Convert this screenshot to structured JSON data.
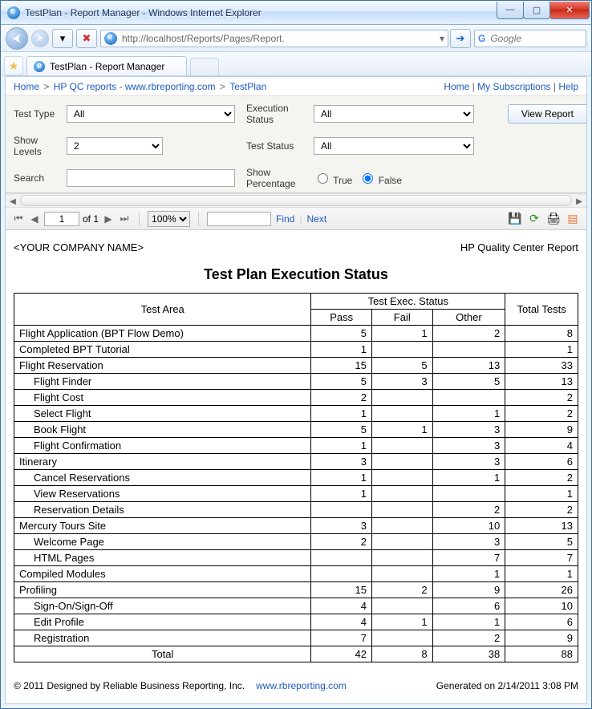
{
  "window": {
    "title": "TestPlan - Report Manager - Windows Internet Explorer"
  },
  "address": {
    "url_display": "http://localhost/Reports/Pages/Report."
  },
  "search": {
    "placeholder": "Google"
  },
  "tab": {
    "title": "TestPlan - Report Manager"
  },
  "breadcrumbs": {
    "left": [
      "Home",
      "HP QC reports - www.rbreporting.com",
      "TestPlan"
    ],
    "right": [
      "Home",
      "My Subscriptions",
      "Help"
    ]
  },
  "params": {
    "test_type_label": "Test Type",
    "test_type_value": "All",
    "exec_status_label": "Execution Status",
    "exec_status_value": "All",
    "show_levels_label": "Show Levels",
    "show_levels_value": "2",
    "test_status_label": "Test Status",
    "test_status_value": "All",
    "search_label": "Search",
    "search_value": "",
    "show_pct_label": "Show Percentage",
    "show_pct_value": "False",
    "true_label": "True",
    "false_label": "False",
    "view_report_label": "View Report"
  },
  "report_toolbar": {
    "page_current": "1",
    "page_of": "of 1",
    "zoom": "100%",
    "find_label": "Find",
    "next_label": "Next"
  },
  "report": {
    "company": "<YOUR COMPANY NAME>",
    "subtitle_right": "HP Quality Center Report",
    "title": "Test Plan Execution Status",
    "headers": {
      "area": "Test Area",
      "exec_status": "Test Exec. Status",
      "total": "Total Tests",
      "pass": "Pass",
      "fail": "Fail",
      "other": "Other"
    },
    "rows": [
      {
        "name": "Flight Application (BPT Flow Demo)",
        "indent": 0,
        "pass": "5",
        "fail": "1",
        "other": "2",
        "total": "8"
      },
      {
        "name": "Completed BPT Tutorial",
        "indent": 0,
        "pass": "1",
        "fail": "",
        "other": "",
        "total": "1"
      },
      {
        "name": "Flight Reservation",
        "indent": 0,
        "pass": "15",
        "fail": "5",
        "other": "13",
        "total": "33"
      },
      {
        "name": "Flight Finder",
        "indent": 1,
        "pass": "5",
        "fail": "3",
        "other": "5",
        "total": "13"
      },
      {
        "name": "Flight Cost",
        "indent": 1,
        "pass": "2",
        "fail": "",
        "other": "",
        "total": "2"
      },
      {
        "name": "Select Flight",
        "indent": 1,
        "pass": "1",
        "fail": "",
        "other": "1",
        "total": "2"
      },
      {
        "name": "Book Flight",
        "indent": 1,
        "pass": "5",
        "fail": "1",
        "other": "3",
        "total": "9"
      },
      {
        "name": "Flight Confirmation",
        "indent": 1,
        "pass": "1",
        "fail": "",
        "other": "3",
        "total": "4"
      },
      {
        "name": "Itinerary",
        "indent": 0,
        "pass": "3",
        "fail": "",
        "other": "3",
        "total": "6"
      },
      {
        "name": "Cancel Reservations",
        "indent": 1,
        "pass": "1",
        "fail": "",
        "other": "1",
        "total": "2"
      },
      {
        "name": "View Reservations",
        "indent": 1,
        "pass": "1",
        "fail": "",
        "other": "",
        "total": "1"
      },
      {
        "name": "Reservation Details",
        "indent": 1,
        "pass": "",
        "fail": "",
        "other": "2",
        "total": "2"
      },
      {
        "name": "Mercury Tours Site",
        "indent": 0,
        "pass": "3",
        "fail": "",
        "other": "10",
        "total": "13"
      },
      {
        "name": "Welcome Page",
        "indent": 1,
        "pass": "2",
        "fail": "",
        "other": "3",
        "total": "5"
      },
      {
        "name": "HTML Pages",
        "indent": 1,
        "pass": "",
        "fail": "",
        "other": "7",
        "total": "7"
      },
      {
        "name": "Compiled Modules",
        "indent": 0,
        "pass": "",
        "fail": "",
        "other": "1",
        "total": "1"
      },
      {
        "name": "Profiling",
        "indent": 0,
        "pass": "15",
        "fail": "2",
        "other": "9",
        "total": "26"
      },
      {
        "name": "Sign-On/Sign-Off",
        "indent": 1,
        "pass": "4",
        "fail": "",
        "other": "6",
        "total": "10"
      },
      {
        "name": "Edit Profile",
        "indent": 1,
        "pass": "4",
        "fail": "1",
        "other": "1",
        "total": "6"
      },
      {
        "name": "Registration",
        "indent": 1,
        "pass": "7",
        "fail": "",
        "other": "2",
        "total": "9"
      }
    ],
    "total_row": {
      "name": "Total",
      "pass": "42",
      "fail": "8",
      "other": "38",
      "total": "88"
    },
    "footer_left": "© 2011 Designed by Reliable Business Reporting, Inc.",
    "footer_link": "www.rbreporting.com",
    "footer_right": "Generated on 2/14/2011 3:08 PM"
  },
  "chart_data": {
    "type": "table",
    "title": "Test Plan Execution Status",
    "columns": [
      "Test Area",
      "Pass",
      "Fail",
      "Other",
      "Total Tests"
    ],
    "rows": [
      [
        "Flight Application (BPT Flow Demo)",
        5,
        1,
        2,
        8
      ],
      [
        "Completed BPT Tutorial",
        1,
        null,
        null,
        1
      ],
      [
        "Flight Reservation",
        15,
        5,
        13,
        33
      ],
      [
        "Flight Reservation / Flight Finder",
        5,
        3,
        5,
        13
      ],
      [
        "Flight Reservation / Flight Cost",
        2,
        null,
        null,
        2
      ],
      [
        "Flight Reservation / Select Flight",
        1,
        null,
        1,
        2
      ],
      [
        "Flight Reservation / Book Flight",
        5,
        1,
        3,
        9
      ],
      [
        "Flight Reservation / Flight Confirmation",
        1,
        null,
        3,
        4
      ],
      [
        "Itinerary",
        3,
        null,
        3,
        6
      ],
      [
        "Itinerary / Cancel Reservations",
        1,
        null,
        1,
        2
      ],
      [
        "Itinerary / View Reservations",
        1,
        null,
        null,
        1
      ],
      [
        "Itinerary / Reservation Details",
        null,
        null,
        2,
        2
      ],
      [
        "Mercury Tours Site",
        3,
        null,
        10,
        13
      ],
      [
        "Mercury Tours Site / Welcome Page",
        2,
        null,
        3,
        5
      ],
      [
        "Mercury Tours Site / HTML Pages",
        null,
        null,
        7,
        7
      ],
      [
        "Compiled Modules",
        null,
        null,
        1,
        1
      ],
      [
        "Profiling",
        15,
        2,
        9,
        26
      ],
      [
        "Profiling / Sign-On/Sign-Off",
        4,
        null,
        6,
        10
      ],
      [
        "Profiling / Edit Profile",
        4,
        1,
        1,
        6
      ],
      [
        "Profiling / Registration",
        7,
        null,
        2,
        9
      ]
    ],
    "totals": {
      "Pass": 42,
      "Fail": 8,
      "Other": 38,
      "Total Tests": 88
    }
  }
}
